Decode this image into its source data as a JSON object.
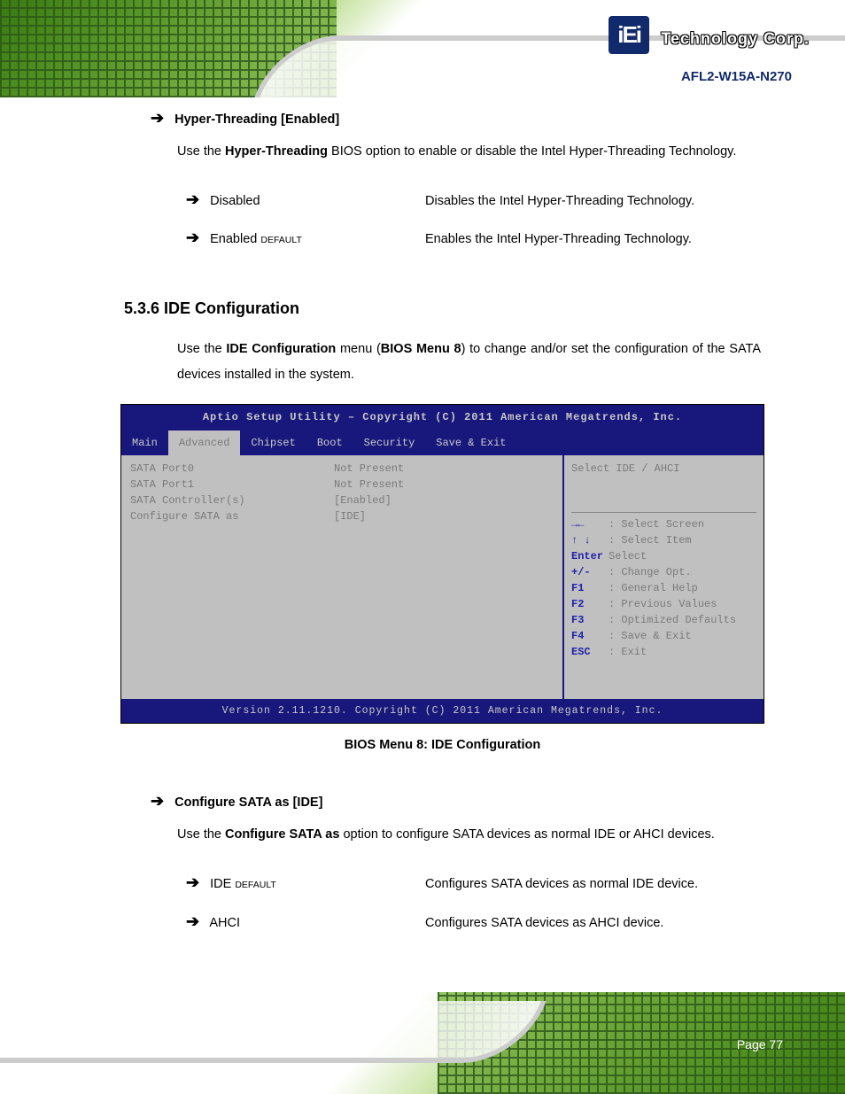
{
  "header": {
    "logo_main": "iEi",
    "logo_r": "®",
    "logo_text": "Technology Corp.",
    "product": "AFL2-W15A-N270"
  },
  "sect1": {
    "title": "Hyper-Threading [Enabled]",
    "intro_pre": "Use the ",
    "intro_bold": "Hyper-Threading",
    "intro_post": " BIOS option to enable or disable the Intel Hyper-Threading Technology.",
    "opts": [
      {
        "label": "Disabled",
        "default": "",
        "desc": "Disables the Intel Hyper-Threading Technology."
      },
      {
        "label": "Enabled",
        "default": "DEFAULT",
        "desc": "Enables the Intel Hyper-Threading Technology."
      }
    ]
  },
  "sect2": {
    "heading": "5.3.6 IDE Configuration",
    "intro_pre": "Use the ",
    "intro_bold": "IDE Configuration",
    "intro_mid": " menu (",
    "intro_ref": "BIOS Menu 8",
    "intro_post": ") to change and/or set the configuration of the SATA devices installed in the system."
  },
  "bios": {
    "title": "Aptio Setup Utility – Copyright (C) 2011 American Megatrends, Inc.",
    "tabs": [
      "Main",
      "Advanced",
      "Chipset",
      "Boot",
      "Security",
      "Save & Exit"
    ],
    "active_tab": 1,
    "left_rows": [
      {
        "k": "SATA Port0",
        "v": "Not Present"
      },
      {
        "k": "SATA Port1",
        "v": "Not Present"
      },
      {
        "k": "",
        "v": ""
      },
      {
        "k": "SATA Controller(s)",
        "v": "[Enabled]"
      },
      {
        "k": "Configure SATA as",
        "v": "[IDE]"
      }
    ],
    "help_top": "Select IDE / AHCI",
    "keyhelp": [
      {
        "sym": "→←",
        "txt": ": Select Screen"
      },
      {
        "sym": "↑ ↓",
        "txt": ": Select Item"
      },
      {
        "sym": "Enter",
        "txt": "Select"
      },
      {
        "sym": "+/-",
        "txt": ": Change Opt."
      },
      {
        "sym": "F1",
        "txt": ": General Help"
      },
      {
        "sym": "F2",
        "txt": ": Previous Values"
      },
      {
        "sym": "F3",
        "txt": ": Optimized Defaults"
      },
      {
        "sym": "F4",
        "txt": ": Save & Exit"
      },
      {
        "sym": "ESC",
        "txt": ": Exit"
      }
    ],
    "footer": "Version 2.11.1210. Copyright (C) 2011 American Megatrends, Inc.",
    "caption": "BIOS Menu 8: IDE Configuration"
  },
  "sect3": {
    "title": "Configure SATA as [IDE]",
    "intro_pre": "Use the ",
    "intro_bold": "Configure SATA as",
    "intro_post": " option to configure SATA devices as normal IDE or AHCI devices.",
    "opts": [
      {
        "label": "IDE",
        "default": "DEFAULT",
        "desc": "Configures SATA devices as normal IDE device."
      },
      {
        "label": "AHCI",
        "default": "",
        "desc": "Configures SATA devices as AHCI device."
      }
    ]
  },
  "footer": {
    "page": "Page 77"
  }
}
